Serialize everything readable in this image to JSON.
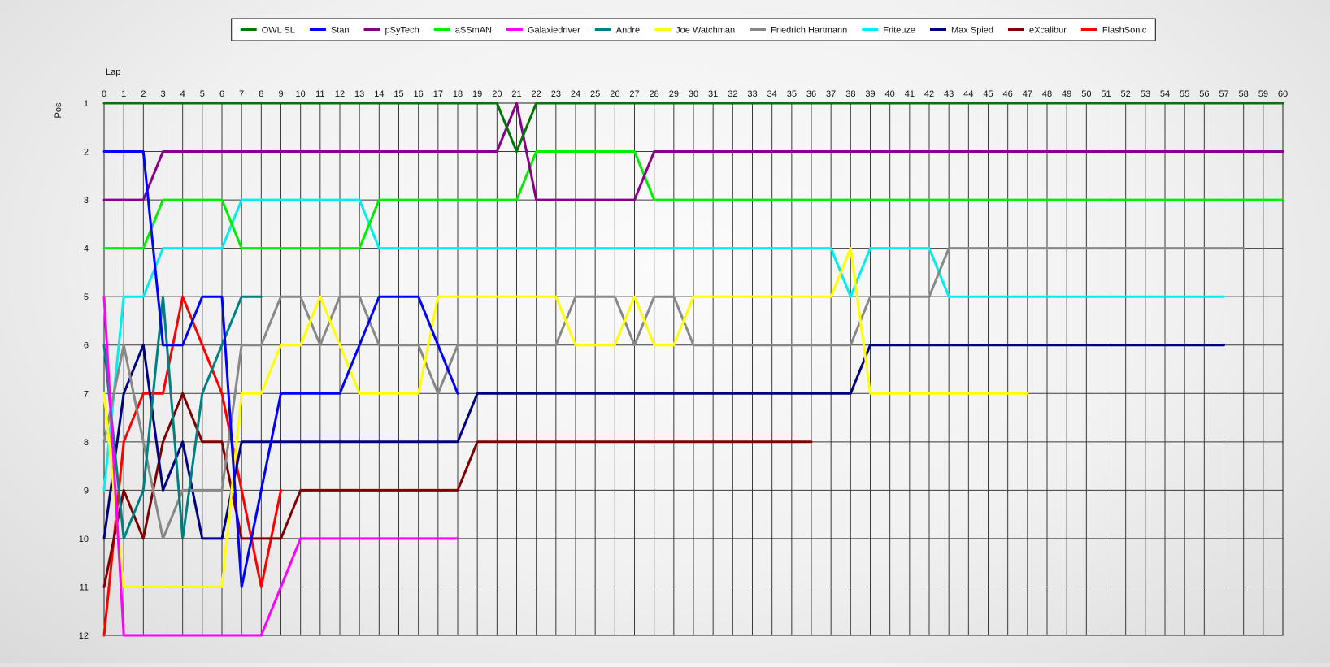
{
  "chart_data": {
    "type": "line",
    "xlabel": "Lap",
    "ylabel": "Pos",
    "xlim": [
      0,
      60
    ],
    "ylim": [
      1,
      12
    ],
    "y_inverted": true,
    "grid": true,
    "legend_position": "top-center",
    "x_ticks": [
      0,
      1,
      2,
      3,
      4,
      5,
      6,
      7,
      8,
      9,
      10,
      11,
      12,
      13,
      14,
      15,
      16,
      17,
      18,
      19,
      20,
      21,
      22,
      23,
      24,
      25,
      26,
      27,
      28,
      29,
      30,
      31,
      32,
      33,
      34,
      35,
      36,
      37,
      38,
      39,
      40,
      41,
      42,
      43,
      44,
      45,
      46,
      47,
      48,
      49,
      50,
      51,
      52,
      53,
      54,
      55,
      56,
      57,
      58,
      59,
      60
    ],
    "y_ticks": [
      1,
      2,
      3,
      4,
      5,
      6,
      7,
      8,
      9,
      10,
      11,
      12
    ],
    "series": [
      {
        "name": "OWL SL",
        "color": "#007700",
        "values": [
          1,
          1,
          1,
          1,
          1,
          1,
          1,
          1,
          1,
          1,
          1,
          1,
          1,
          1,
          1,
          1,
          1,
          1,
          1,
          1,
          1,
          2,
          1,
          1,
          1,
          1,
          1,
          1,
          1,
          1,
          1,
          1,
          1,
          1,
          1,
          1,
          1,
          1,
          1,
          1,
          1,
          1,
          1,
          1,
          1,
          1,
          1,
          1,
          1,
          1,
          1,
          1,
          1,
          1,
          1,
          1,
          1,
          1,
          1,
          1,
          1
        ]
      },
      {
        "name": "Stan",
        "color": "#0000ff",
        "values": [
          2,
          2,
          2,
          6,
          6,
          5,
          5,
          11,
          9,
          7,
          7,
          7,
          7,
          6,
          5,
          5,
          5,
          6,
          7
        ]
      },
      {
        "name": "pSyTech",
        "color": "#880088",
        "values": [
          3,
          3,
          3,
          2,
          2,
          2,
          2,
          2,
          2,
          2,
          2,
          2,
          2,
          2,
          2,
          2,
          2,
          2,
          2,
          2,
          2,
          1,
          3,
          3,
          3,
          3,
          3,
          3,
          2,
          2,
          2,
          2,
          2,
          2,
          2,
          2,
          2,
          2,
          2,
          2,
          2,
          2,
          2,
          2,
          2,
          2,
          2,
          2,
          2,
          2,
          2,
          2,
          2,
          2,
          2,
          2,
          2,
          2,
          2,
          2,
          2
        ]
      },
      {
        "name": "aSSmAN",
        "color": "#00ee00",
        "values": [
          4,
          4,
          4,
          3,
          3,
          3,
          3,
          4,
          4,
          4,
          4,
          4,
          4,
          4,
          3,
          3,
          3,
          3,
          3,
          3,
          3,
          3,
          2,
          2,
          2,
          2,
          2,
          2,
          3,
          3,
          3,
          3,
          3,
          3,
          3,
          3,
          3,
          3,
          3,
          3,
          3,
          3,
          3,
          3,
          3,
          3,
          3,
          3,
          3,
          3,
          3,
          3,
          3,
          3,
          3,
          3,
          3,
          3,
          3,
          3,
          3
        ]
      },
      {
        "name": "Galaxiedriver",
        "color": "#ff00ff",
        "values": [
          5,
          12,
          12,
          12,
          12,
          12,
          12,
          12,
          12,
          11,
          10,
          10,
          10,
          10,
          10,
          10,
          10,
          10,
          10
        ]
      },
      {
        "name": "Andre",
        "color": "#008080",
        "values": [
          6,
          10,
          9,
          5,
          10,
          7,
          6,
          5,
          5
        ]
      },
      {
        "name": "Joe Watchman",
        "color": "#ffff00",
        "values": [
          7,
          11,
          11,
          11,
          11,
          11,
          11,
          7,
          7,
          6,
          6,
          5,
          6,
          7,
          7,
          7,
          7,
          5,
          5,
          5,
          5,
          5,
          5,
          5,
          6,
          6,
          6,
          5,
          6,
          6,
          5,
          5,
          5,
          5,
          5,
          5,
          5,
          5,
          4,
          7,
          7,
          7,
          7,
          7,
          7,
          7,
          7,
          7
        ]
      },
      {
        "name": "Friedrich Hartmann",
        "color": "#888888",
        "values": [
          8,
          6,
          8,
          10,
          9,
          9,
          9,
          6,
          6,
          5,
          5,
          6,
          5,
          5,
          6,
          6,
          6,
          7,
          6,
          6,
          6,
          6,
          6,
          6,
          5,
          5,
          5,
          6,
          5,
          5,
          6,
          6,
          6,
          6,
          6,
          6,
          6,
          6,
          6,
          5,
          5,
          5,
          5,
          4,
          4,
          4,
          4,
          4,
          4,
          4,
          4,
          4,
          4,
          4,
          4,
          4,
          4,
          4,
          4
        ]
      },
      {
        "name": "Friteuze",
        "color": "#00eeee",
        "values": [
          9,
          5,
          5,
          4,
          4,
          4,
          4,
          3,
          3,
          3,
          3,
          3,
          3,
          3,
          4,
          4,
          4,
          4,
          4,
          4,
          4,
          4,
          4,
          4,
          4,
          4,
          4,
          4,
          4,
          4,
          4,
          4,
          4,
          4,
          4,
          4,
          4,
          4,
          5,
          4,
          4,
          4,
          4,
          5,
          5,
          5,
          5,
          5,
          5,
          5,
          5,
          5,
          5,
          5,
          5,
          5,
          5,
          5
        ]
      },
      {
        "name": "Max Spied",
        "color": "#000080",
        "values": [
          10,
          7,
          6,
          9,
          8,
          10,
          10,
          8,
          8,
          8,
          8,
          8,
          8,
          8,
          8,
          8,
          8,
          8,
          8,
          7,
          7,
          7,
          7,
          7,
          7,
          7,
          7,
          7,
          7,
          7,
          7,
          7,
          7,
          7,
          7,
          7,
          7,
          7,
          7,
          6,
          6,
          6,
          6,
          6,
          6,
          6,
          6,
          6,
          6,
          6,
          6,
          6,
          6,
          6,
          6,
          6,
          6,
          6
        ]
      },
      {
        "name": "eXcalibur",
        "color": "#800000",
        "values": [
          11,
          9,
          10,
          8,
          7,
          8,
          8,
          10,
          10,
          10,
          9,
          9,
          9,
          9,
          9,
          9,
          9,
          9,
          9,
          8,
          8,
          8,
          8,
          8,
          8,
          8,
          8,
          8,
          8,
          8,
          8,
          8,
          8,
          8,
          8,
          8,
          8
        ]
      },
      {
        "name": "FlashSonic",
        "color": "#ff0000",
        "values": [
          12,
          8,
          7,
          7,
          5,
          6,
          7,
          9,
          11,
          9
        ]
      }
    ]
  }
}
